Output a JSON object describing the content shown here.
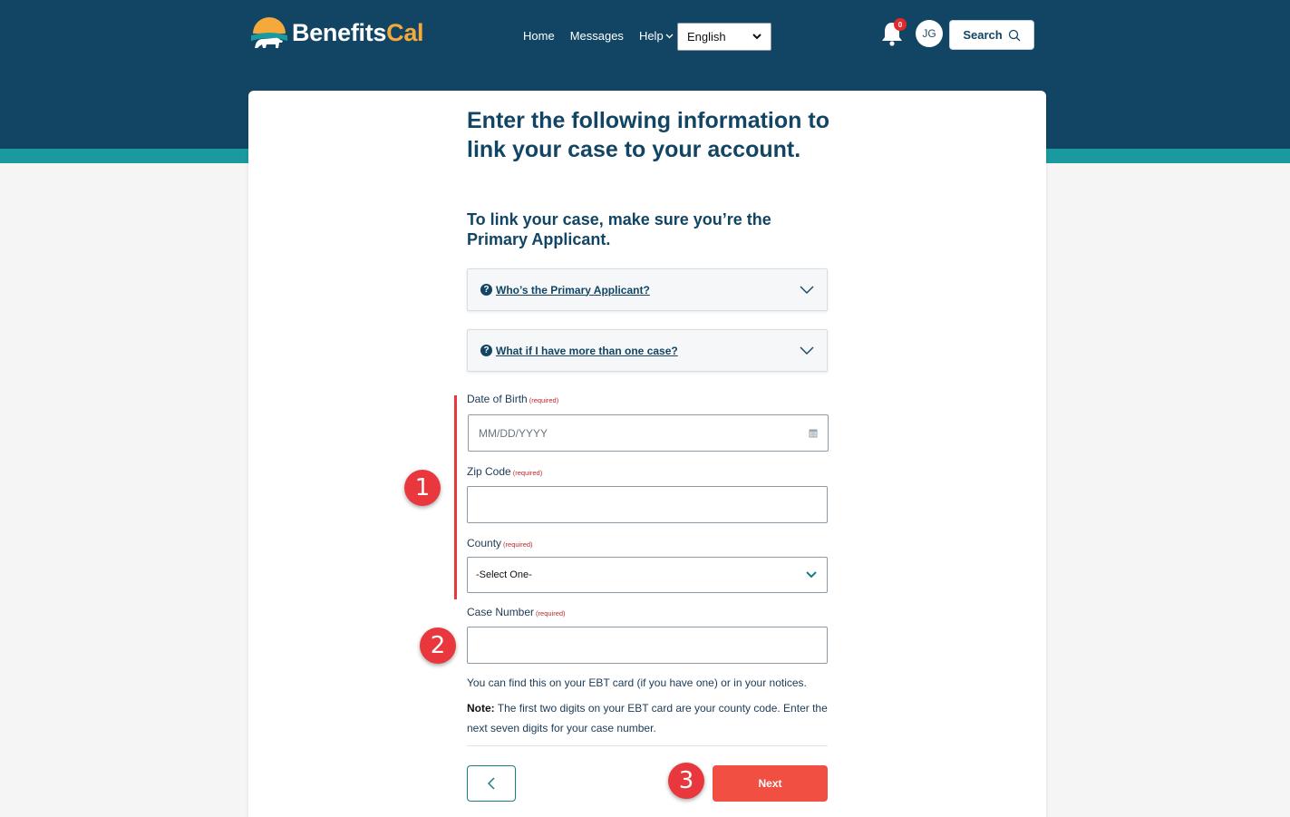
{
  "header": {
    "logo_text_main": "Benefits",
    "logo_text_accent": "Cal",
    "nav": [
      "Home",
      "Messages",
      "Help"
    ],
    "language": "English",
    "notification_count": "0",
    "avatar_initials": "JG",
    "search_label": "Search"
  },
  "page": {
    "title": "Enter the following information to link your case to your account.",
    "subtitle": "To link your case, make sure you’re the Primary Applicant.",
    "accordions": [
      {
        "label": "Who’s the Primary Applicant?"
      },
      {
        "label": "What if I have more than one case?"
      }
    ],
    "required_tag": "(required)",
    "fields": {
      "dob_label": "Date of Birth",
      "dob_placeholder": "MM/DD/YYYY",
      "zip_label": "Zip Code",
      "county_label": "County",
      "county_value": "-Select One-",
      "case_label": "Case Number"
    },
    "help_text": "You can find this on your EBT card (if you have one) or in your notices.",
    "note_label": "Note:",
    "note_text": "The first two digits on your EBT card are your county code. Enter the next seven digits for your case number.",
    "next_label": "Next"
  },
  "annotations": [
    "1",
    "2",
    "3"
  ],
  "colors": {
    "header_bg": "#124564",
    "teal_strip": "#1a9a9e",
    "accent_orange": "#f4a93a",
    "next_button": "#f04f42",
    "annotation_red": "#e8383d"
  }
}
